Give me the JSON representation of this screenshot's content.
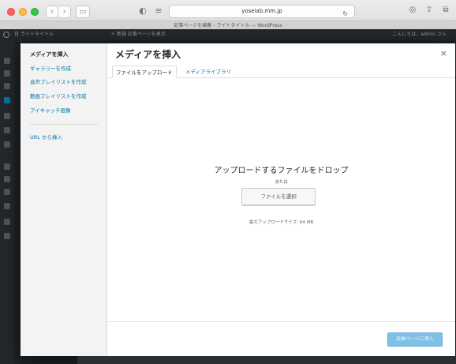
{
  "browser": {
    "address": "yoseiab.mm.jp",
    "tab_title": "記事ページを編集 ‹ ライトタイトル — WordPress"
  },
  "admin_bar": {
    "site": "日 ライトタイトル",
    "new": "＋ 新規   記事ページを表示",
    "user": "こんにちは、admin さん"
  },
  "modal": {
    "menu_heading": "メディアを挿入",
    "menu_items": [
      "ギャラリーを作成",
      "音声プレイリストを作成",
      "動画プレイリストを作成",
      "アイキャッチ画像"
    ],
    "url_insert": "URL から挿入",
    "title": "メディアを挿入",
    "close": "×",
    "tabs": [
      "ファイルをアップロード",
      "メディアライブラリ"
    ],
    "drop_title": "アップロードするファイルをドロップ",
    "or_text": "または",
    "select_button": "ファイルを選択",
    "max_upload": "最大アップロードサイズ: 64 MB",
    "insert_button": "投稿ページに挿入"
  },
  "colors": {
    "accent": "#0073aa",
    "insert_disabled": "#7fc1e6"
  }
}
